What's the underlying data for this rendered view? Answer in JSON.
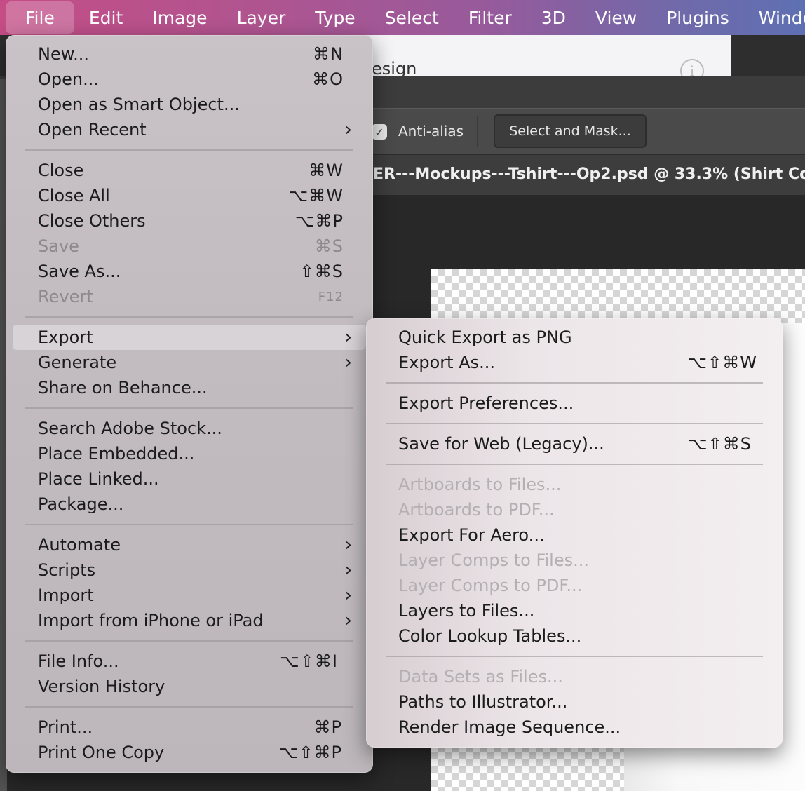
{
  "menubar": {
    "items": [
      "File",
      "Edit",
      "Image",
      "Layer",
      "Type",
      "Select",
      "Filter",
      "3D",
      "View",
      "Plugins",
      "Window"
    ]
  },
  "background": {
    "dialog_text": "esign",
    "anti_alias_label": "Anti-alias",
    "select_mask_button": "Select and Mask...",
    "document_title": "ER---Mockups---Tshirt---Op2.psd @ 33.3% (Shirt Co"
  },
  "file_menu": {
    "items": [
      {
        "label": "New...",
        "shortcut": "⌘N"
      },
      {
        "label": "Open...",
        "shortcut": "⌘O"
      },
      {
        "label": "Open as Smart Object...",
        "shortcut": ""
      },
      {
        "label": "Open Recent",
        "shortcut": ""
      },
      {
        "label": "Close",
        "shortcut": "⌘W"
      },
      {
        "label": "Close All",
        "shortcut": "⌥⌘W"
      },
      {
        "label": "Close Others",
        "shortcut": "⌥⌘P"
      },
      {
        "label": "Save",
        "shortcut": "⌘S"
      },
      {
        "label": "Save As...",
        "shortcut": "⇧⌘S"
      },
      {
        "label": "Revert",
        "shortcut": "F12"
      },
      {
        "label": "Export",
        "shortcut": ""
      },
      {
        "label": "Generate",
        "shortcut": ""
      },
      {
        "label": "Share on Behance...",
        "shortcut": ""
      },
      {
        "label": "Search Adobe Stock...",
        "shortcut": ""
      },
      {
        "label": "Place Embedded...",
        "shortcut": ""
      },
      {
        "label": "Place Linked...",
        "shortcut": ""
      },
      {
        "label": "Package...",
        "shortcut": ""
      },
      {
        "label": "Automate",
        "shortcut": ""
      },
      {
        "label": "Scripts",
        "shortcut": ""
      },
      {
        "label": "Import",
        "shortcut": ""
      },
      {
        "label": "Import from iPhone or iPad",
        "shortcut": ""
      },
      {
        "label": "File Info...",
        "shortcut": "⌥⇧⌘I"
      },
      {
        "label": "Version History",
        "shortcut": ""
      },
      {
        "label": "Print...",
        "shortcut": "⌘P"
      },
      {
        "label": "Print One Copy",
        "shortcut": "⌥⇧⌘P"
      }
    ]
  },
  "export_menu": {
    "items": [
      {
        "label": "Quick Export as PNG",
        "shortcut": ""
      },
      {
        "label": "Export As...",
        "shortcut": "⌥⇧⌘W"
      },
      {
        "label": "Export Preferences...",
        "shortcut": ""
      },
      {
        "label": "Save for Web (Legacy)...",
        "shortcut": "⌥⇧⌘S"
      },
      {
        "label": "Artboards to Files...",
        "shortcut": ""
      },
      {
        "label": "Artboards to PDF...",
        "shortcut": ""
      },
      {
        "label": "Export For Aero...",
        "shortcut": ""
      },
      {
        "label": "Layer Comps to Files...",
        "shortcut": ""
      },
      {
        "label": "Layer Comps to PDF...",
        "shortcut": ""
      },
      {
        "label": "Layers to Files...",
        "shortcut": ""
      },
      {
        "label": "Color Lookup Tables...",
        "shortcut": ""
      },
      {
        "label": "Data Sets as Files...",
        "shortcut": ""
      },
      {
        "label": "Paths to Illustrator...",
        "shortcut": ""
      },
      {
        "label": "Render Image Sequence...",
        "shortcut": ""
      }
    ]
  }
}
